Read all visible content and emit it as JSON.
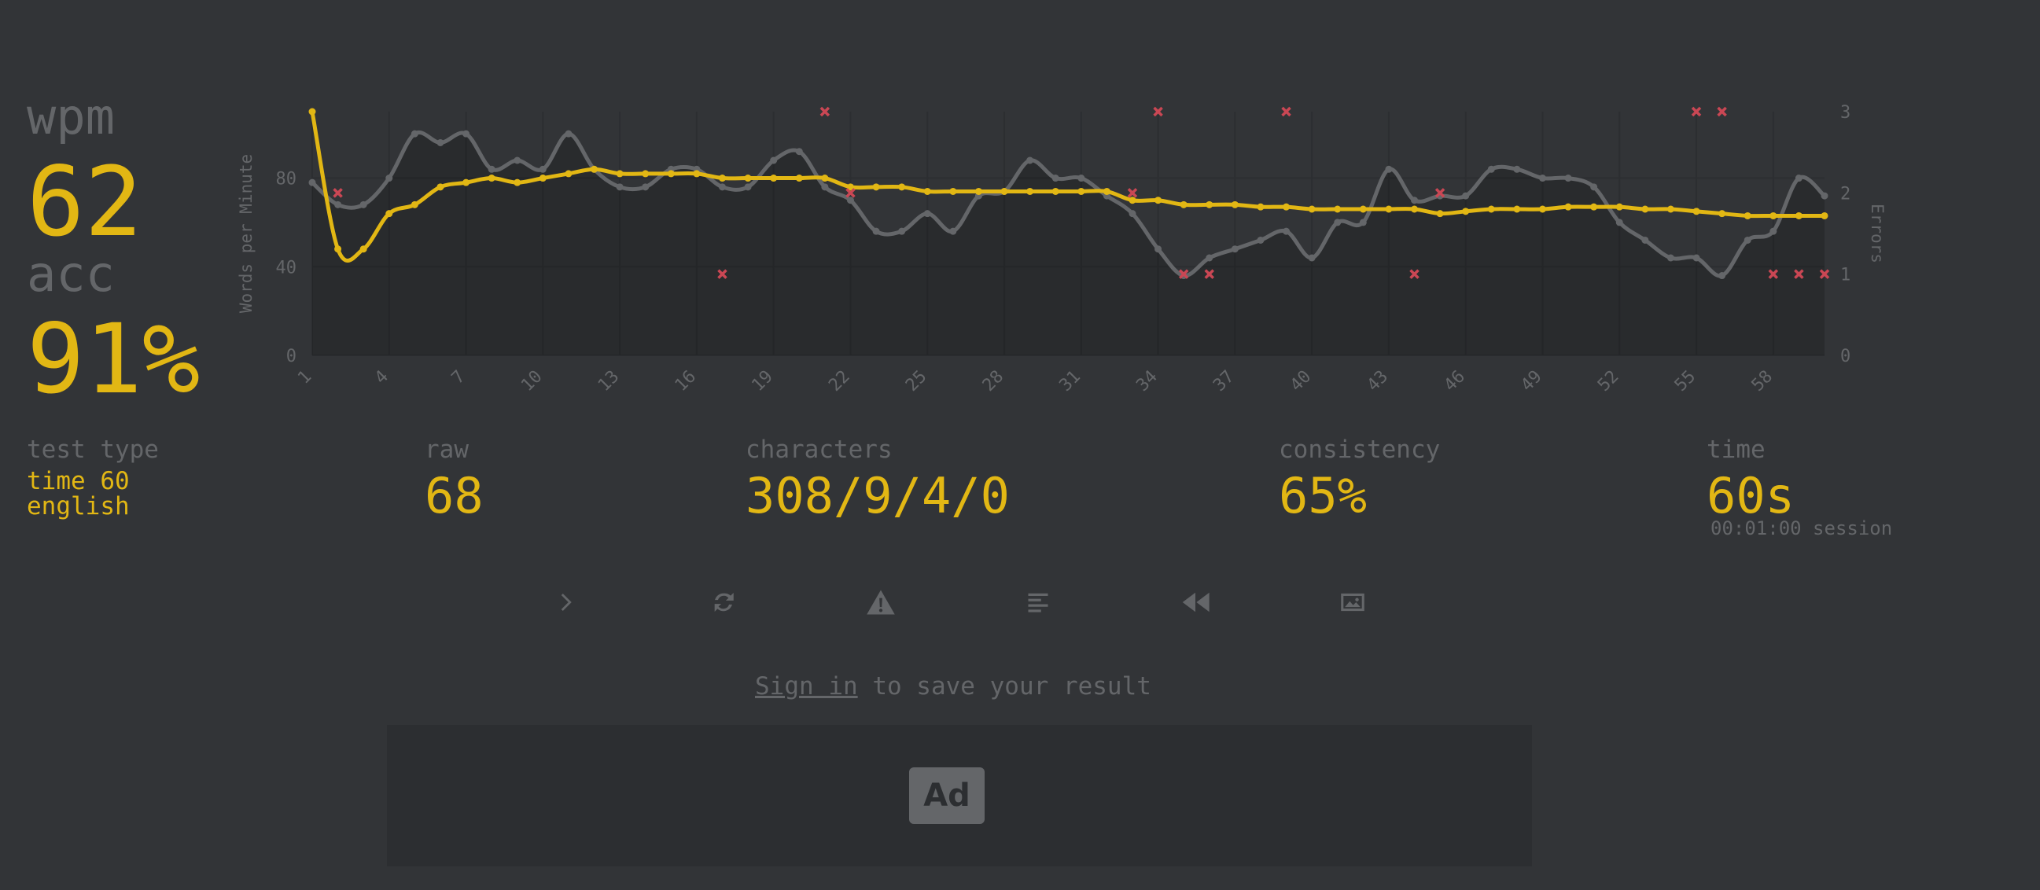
{
  "stats": {
    "wpm_label": "wpm",
    "wpm_value": "62",
    "acc_label": "acc",
    "acc_value": "91%"
  },
  "details": {
    "test_type_label": "test type",
    "test_type_line1": "time 60",
    "test_type_line2": "english",
    "raw_label": "raw",
    "raw_value": "68",
    "characters_label": "characters",
    "characters_value": "308/9/4/0",
    "consistency_label": "consistency",
    "consistency_value": "65%",
    "time_label": "time",
    "time_value": "60s",
    "session": "00:01:00 session"
  },
  "buttons": [
    "next-test",
    "restart",
    "report",
    "word-history",
    "replay",
    "screenshot"
  ],
  "signin": {
    "link": "Sign in",
    "rest": " to save your result"
  },
  "ad": {
    "label": "Ad"
  },
  "colors": {
    "background": "#323437",
    "main": "#e2b714",
    "sub": "#646669",
    "error": "#ca4754"
  },
  "chart_data": {
    "type": "line",
    "ylabel": "Words per Minute",
    "y2label": "Errors",
    "ylim": [
      0,
      110
    ],
    "y2lim": [
      0,
      3
    ],
    "yticks": [
      0,
      40,
      80
    ],
    "y2ticks": [
      0,
      1,
      2,
      3
    ],
    "xlim": [
      1,
      60
    ],
    "xticks": [
      1,
      4,
      7,
      10,
      13,
      16,
      19,
      22,
      25,
      28,
      31,
      34,
      37,
      40,
      43,
      46,
      49,
      52,
      55,
      58
    ],
    "grid": true,
    "series": [
      {
        "name": "raw",
        "color": "#646669",
        "values": [
          78,
          68,
          68,
          80,
          100,
          96,
          100,
          84,
          88,
          84,
          100,
          84,
          76,
          76,
          84,
          84,
          76,
          76,
          88,
          92,
          76,
          70,
          56,
          56,
          64,
          56,
          72,
          74,
          88,
          80,
          80,
          72,
          64,
          48,
          36,
          44,
          48,
          52,
          56,
          44,
          60,
          60,
          84,
          70,
          72,
          72,
          84,
          84,
          80,
          80,
          76,
          60,
          52,
          44,
          44,
          36,
          52,
          56,
          80,
          72
        ]
      },
      {
        "name": "wpm",
        "color": "#e2b714",
        "values": [
          110,
          48,
          48,
          64,
          68,
          76,
          78,
          80,
          78,
          80,
          82,
          84,
          82,
          82,
          82,
          82,
          80,
          80,
          80,
          80,
          80,
          76,
          76,
          76,
          74,
          74,
          74,
          74,
          74,
          74,
          74,
          74,
          70,
          70,
          68,
          68,
          68,
          67,
          67,
          66,
          66,
          66,
          66,
          66,
          64,
          65,
          66,
          66,
          66,
          67,
          67,
          67,
          66,
          66,
          65,
          64,
          63,
          63,
          63,
          63
        ]
      }
    ],
    "errors": [
      {
        "x": 2,
        "y": 2
      },
      {
        "x": 17,
        "y": 1
      },
      {
        "x": 21,
        "y": 3
      },
      {
        "x": 22,
        "y": 2
      },
      {
        "x": 33,
        "y": 2
      },
      {
        "x": 34,
        "y": 3
      },
      {
        "x": 35,
        "y": 1
      },
      {
        "x": 36,
        "y": 1
      },
      {
        "x": 39,
        "y": 3
      },
      {
        "x": 44,
        "y": 1
      },
      {
        "x": 45,
        "y": 2
      },
      {
        "x": 55,
        "y": 3
      },
      {
        "x": 56,
        "y": 3
      },
      {
        "x": 58,
        "y": 1
      },
      {
        "x": 59,
        "y": 1
      },
      {
        "x": 60,
        "y": 1
      }
    ]
  }
}
